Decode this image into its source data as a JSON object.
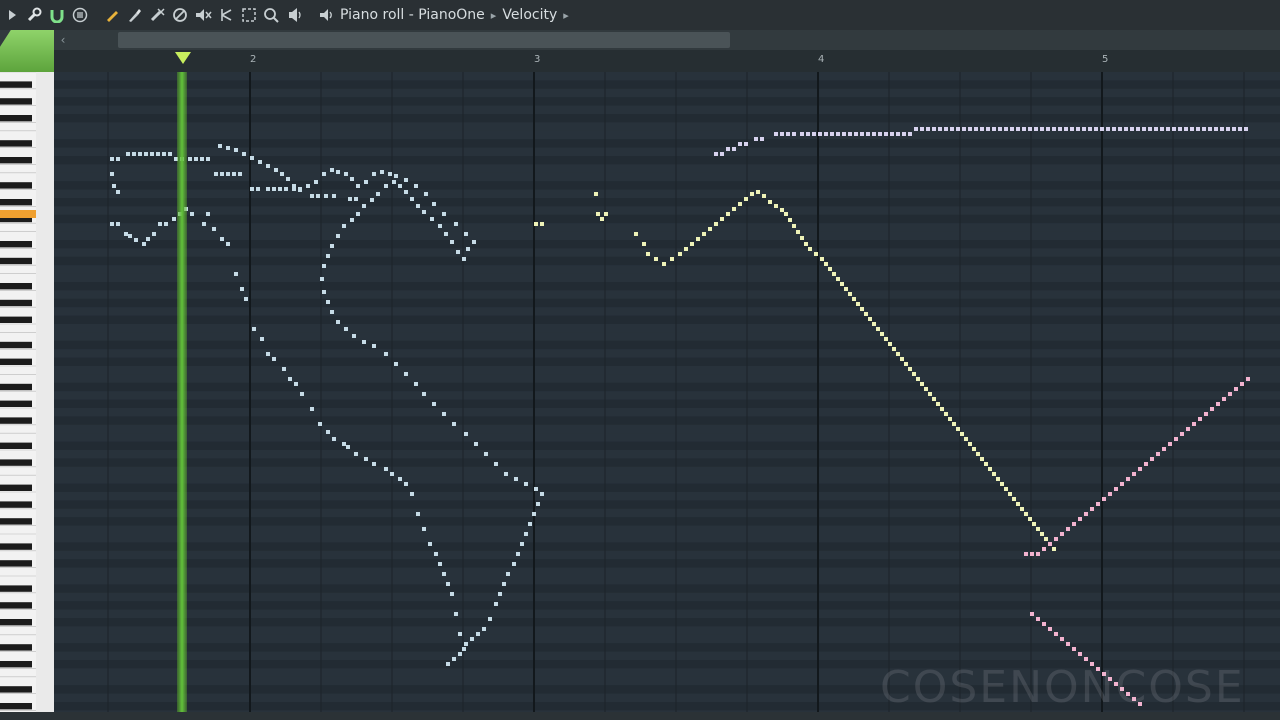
{
  "toolbar": {
    "buttons": [
      {
        "name": "play-arrow-icon"
      },
      {
        "name": "wrench-icon"
      },
      {
        "name": "magnet-icon"
      },
      {
        "name": "menu-icon"
      },
      {
        "name": "pencil-icon"
      },
      {
        "name": "paint-brush-icon"
      },
      {
        "name": "delete-tool-icon"
      },
      {
        "name": "mute-tool-icon"
      },
      {
        "name": "speaker-mute-icon"
      },
      {
        "name": "slice-tool-icon"
      },
      {
        "name": "select-tool-icon"
      },
      {
        "name": "zoom-icon"
      },
      {
        "name": "playback-icon"
      }
    ],
    "accent": "#e8b23a"
  },
  "breadcrumb": {
    "title": "Piano roll - PianoOne",
    "target": "Velocity"
  },
  "ruler": {
    "bars": [
      "2",
      "3",
      "4",
      "5"
    ]
  },
  "watermark": "COSENONCOSE",
  "colors": {
    "grid_bg": "#26303a",
    "playhead": "#62c23a",
    "note_blue": "#c6dbe6",
    "note_yellow": "#eef2b8",
    "note_lavender": "#d7d2ee",
    "note_pink": "#f2b3cf"
  }
}
